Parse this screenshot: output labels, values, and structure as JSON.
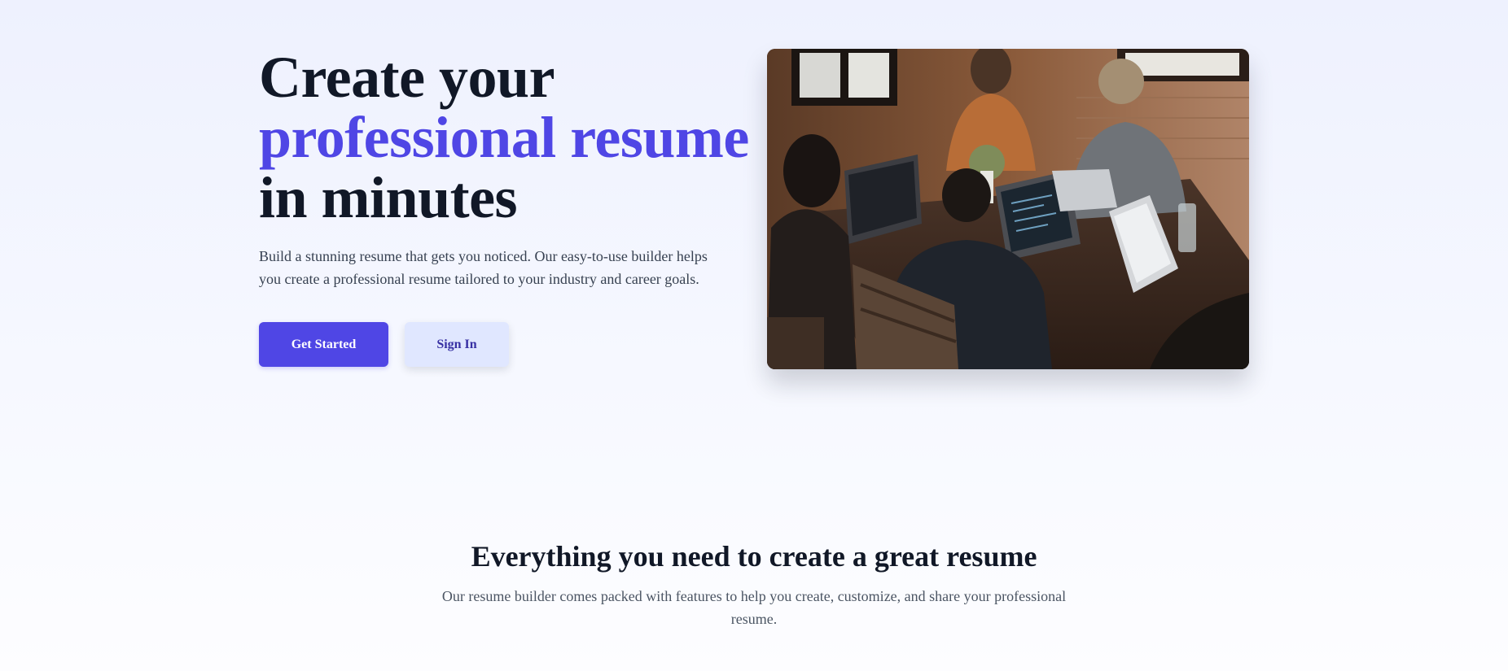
{
  "hero": {
    "title_line1": "Create your",
    "title_line2": "professional resume",
    "title_line3": "in minutes",
    "description": "Build a stunning resume that gets you noticed. Our easy-to-use builder helps you create a professional resume tailored to your industry and career goals.",
    "primary_button": "Get Started",
    "secondary_button": "Sign In",
    "image_icon": "team-collaboration-photo"
  },
  "features": {
    "title": "Everything you need to create a great resume",
    "description": "Our resume builder comes packed with features to help you create, customize, and share your professional resume."
  },
  "colors": {
    "accent": "#4f46e5",
    "heading": "#111827",
    "body_text": "#374151",
    "secondary_button_bg": "#e0e7ff",
    "secondary_button_text": "#3730a3",
    "page_background": "#eef1fe"
  }
}
